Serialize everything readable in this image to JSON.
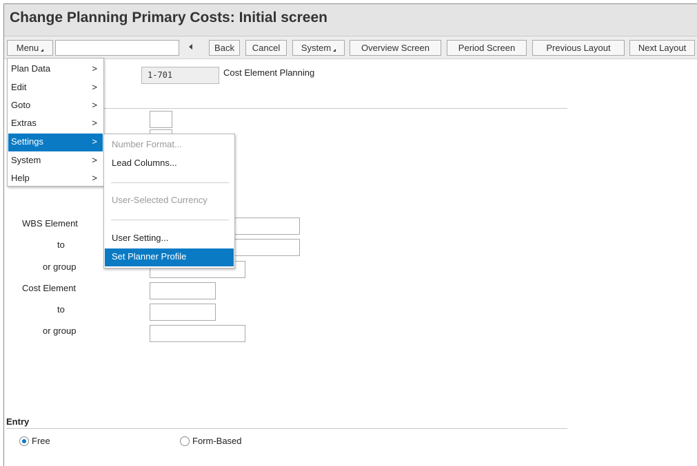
{
  "window": {
    "title": "Change Planning Primary Costs: Initial screen"
  },
  "toolbar": {
    "menu_label": "Menu",
    "back_label": "Back",
    "cancel_label": "Cancel",
    "system_label": "System",
    "overview_label": "Overview Screen",
    "period_label": "Period Screen",
    "prev_layout_label": "Previous Layout",
    "next_layout_label": "Next Layout"
  },
  "layout": {
    "value": "1-701",
    "description": "Cost Element Planning"
  },
  "menu": {
    "items": [
      {
        "label": "Plan Data",
        "arrow": ">"
      },
      {
        "label": "Edit",
        "arrow": ">"
      },
      {
        "label": "Goto",
        "arrow": ">"
      },
      {
        "label": "Extras",
        "arrow": ">"
      },
      {
        "label": "Settings",
        "arrow": ">"
      },
      {
        "label": "System",
        "arrow": ">"
      },
      {
        "label": "Help",
        "arrow": ">"
      }
    ]
  },
  "submenu": {
    "items": [
      {
        "label": "Number Format..."
      },
      {
        "label": "Lead Columns..."
      },
      {
        "label": "User-Selected Currency"
      },
      {
        "label": "User Setting..."
      },
      {
        "label": "Set Planner Profile"
      }
    ]
  },
  "form": {
    "wbs_label": "WBS Element",
    "wbs_to_label": "to",
    "wbs_group_label": "or group",
    "cost_label": "Cost Element",
    "cost_to_label": "to",
    "cost_group_label": "or group"
  },
  "entry": {
    "title": "Entry",
    "free_label": "Free",
    "form_based_label": "Form-Based"
  },
  "colors": {
    "selection": "#0a7ac4",
    "title_bg": "#e4e4e4"
  }
}
